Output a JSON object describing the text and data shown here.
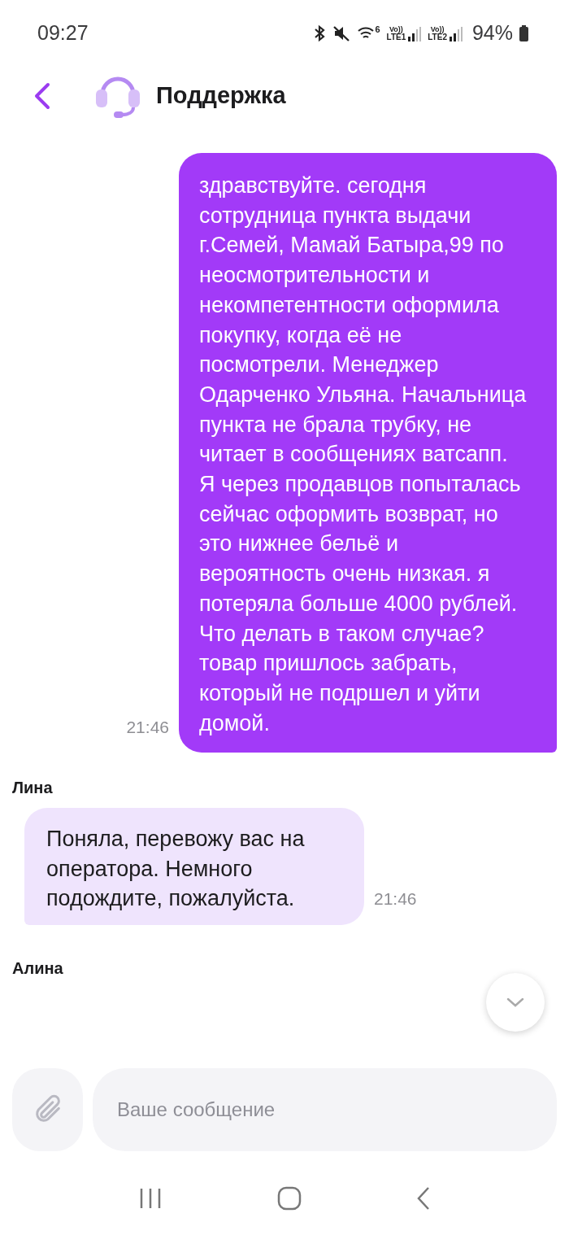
{
  "status_bar": {
    "time": "09:27",
    "wifi_badge": "6",
    "sims": [
      {
        "top": "Vo))",
        "bottom": "LTE1"
      },
      {
        "top": "Vo))",
        "bottom": "LTE2"
      }
    ],
    "battery": "94%"
  },
  "header": {
    "title": "Поддержка"
  },
  "messages": [
    {
      "kind": "outgoing",
      "text": "здравствуйте. сегодня сотрудница пункта выдачи г.Семей, Мамай Батыра,99 по неосмотрительности и некомпетентности оформила покупку, когда её не посмотрели. Менеджер Одарченко Ульяна. Начальница пункта не брала трубку, не читает в сообщениях ватсапп. Я через продавцов попыталась сейчас оформить возврат, но это нижнее бельё и вероятность очень низкая. я потеряла больше 4000 рублей. Что делать в таком случае? товар пришлось забрать, который не подршел и уйти домой.",
      "time": "21:46"
    },
    {
      "kind": "incoming",
      "sender": "Лина",
      "text": "Поняла, перевожу вас на оператора. Немного подождите, пожалуйста.",
      "time": "21:46"
    },
    {
      "kind": "sender_only",
      "sender": "Алина"
    }
  ],
  "composer": {
    "placeholder": "Ваше сообщение"
  }
}
